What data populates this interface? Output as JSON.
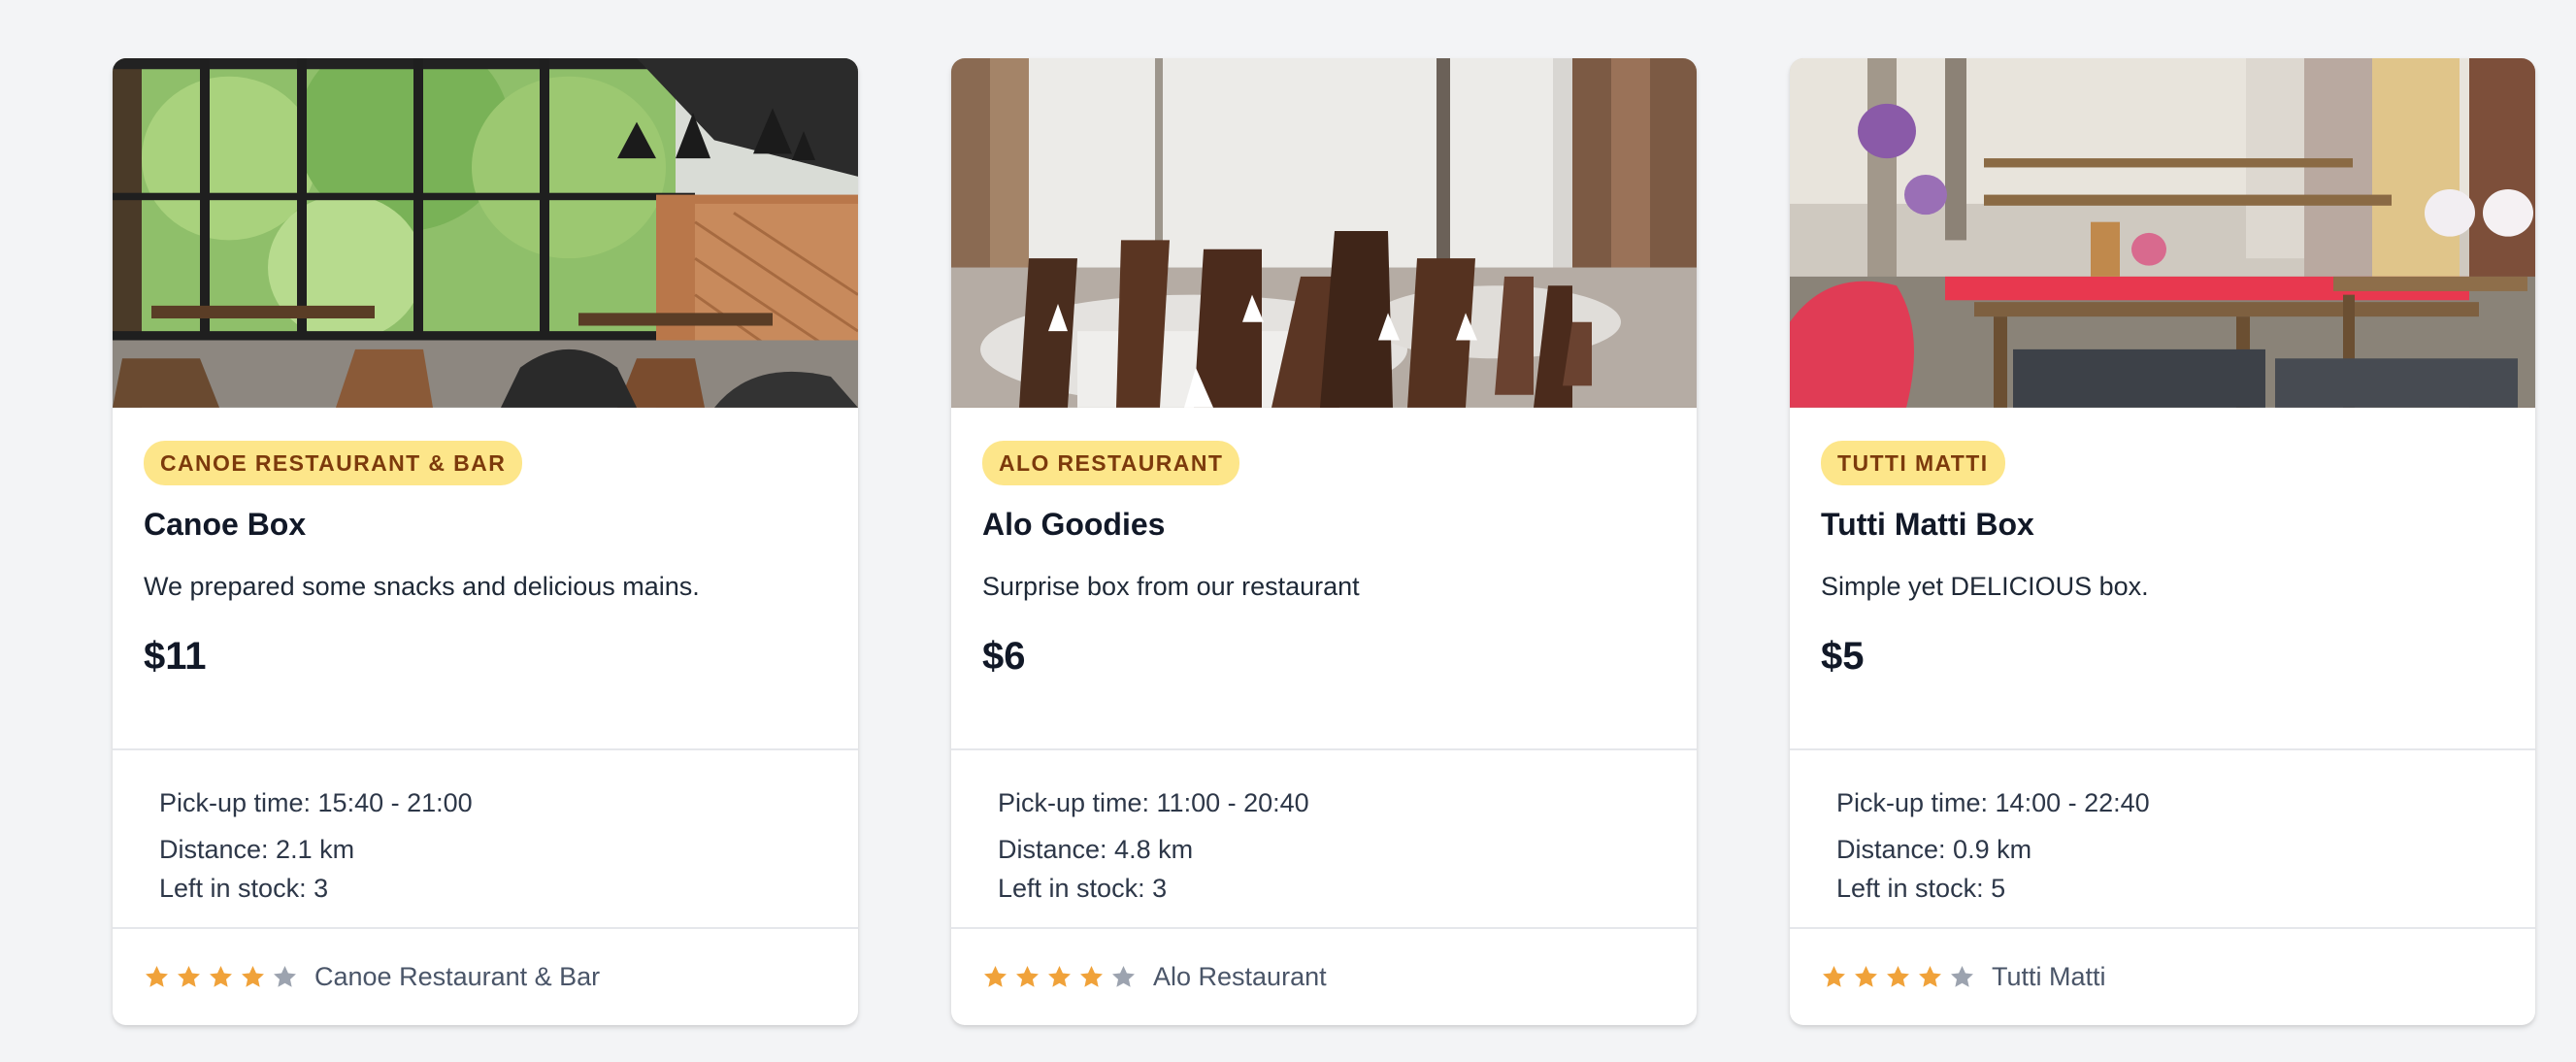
{
  "colors": {
    "badge_bg": "#fde68a",
    "badge_text": "#7c3a0c",
    "star_filled": "#f0a23a",
    "star_empty": "#9ca3af"
  },
  "cards": [
    {
      "photo": "restaurant-interior-photo-large-windows",
      "badge": "CANOE RESTAURANT & BAR",
      "title": "Canoe Box",
      "description": "We prepared some snacks and delicious mains.",
      "price": "$11",
      "pickup": "Pick-up time: 15:40 - 21:00",
      "distance": "Distance: 2.1 km",
      "stock": "Left in stock: 3",
      "rating": 4,
      "rating_max": 5,
      "restaurant": "Canoe Restaurant & Bar"
    },
    {
      "photo": "restaurant-dining-room-photo-set-tables",
      "badge": "ALO RESTAURANT",
      "title": "Alo Goodies",
      "description": "Surprise box from our restaurant",
      "price": "$6",
      "pickup": "Pick-up time: 11:00 - 20:40",
      "distance": "Distance: 4.8 km",
      "stock": "Left in stock: 3",
      "rating": 4,
      "rating_max": 5,
      "restaurant": "Alo Restaurant"
    },
    {
      "photo": "restaurant-terrace-photo-wooden-benches",
      "badge": "TUTTI MATTI",
      "title": "Tutti Matti Box",
      "description": "Simple yet DELICIOUS box.",
      "price": "$5",
      "pickup": "Pick-up time: 14:00 - 22:40",
      "distance": "Distance: 0.9 km",
      "stock": "Left in stock: 5",
      "rating": 4,
      "rating_max": 5,
      "restaurant": "Tutti Matti"
    }
  ]
}
